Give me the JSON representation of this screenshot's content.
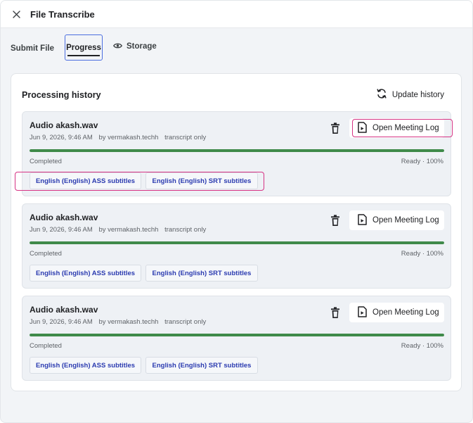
{
  "window": {
    "title": "File Transcribe"
  },
  "tabs": [
    {
      "label": "Submit File",
      "active": false
    },
    {
      "label": "Progress",
      "active": true
    },
    {
      "label": "Storage",
      "icon": "eye-icon",
      "active": false
    }
  ],
  "panel": {
    "title": "Processing history",
    "update_label": "Update history"
  },
  "jobs": [
    {
      "name": "Audio akash.wav",
      "date": "Jun 9, 2026, 9:46 AM",
      "by": "by vermakash.techh",
      "mode": "transcript only",
      "status": "Completed",
      "ready": "Ready · 100%",
      "progress": 1.0,
      "open_log_label": "Open Meeting Log",
      "subtitles": [
        "English (English) ASS subtitles",
        "English (English) SRT subtitles"
      ]
    },
    {
      "name": "Audio akash.wav",
      "date": "Jun 9, 2026, 9:46 AM",
      "by": "by vermakash.techh",
      "mode": "transcript only",
      "status": "Completed",
      "ready": "Ready · 100%",
      "progress": 1.0,
      "open_log_label": "Open Meeting Log",
      "subtitles": [
        "English (English) ASS subtitles",
        "English (English) SRT subtitles"
      ]
    },
    {
      "name": "Audio akash.wav",
      "date": "Jun 9, 2026, 9:46 AM",
      "by": "by vermakash.techh",
      "mode": "transcript only",
      "status": "Completed",
      "ready": "Ready · 100%",
      "progress": 1.0,
      "open_log_label": "Open Meeting Log",
      "subtitles": [
        "English (English) ASS subtitles",
        "English (English) SRT subtitles"
      ]
    }
  ],
  "colors": {
    "accent": "#4b6ee0",
    "highlight": "#d63384",
    "progress": "#3f8a4a",
    "chip_text": "#2b3bb0"
  }
}
